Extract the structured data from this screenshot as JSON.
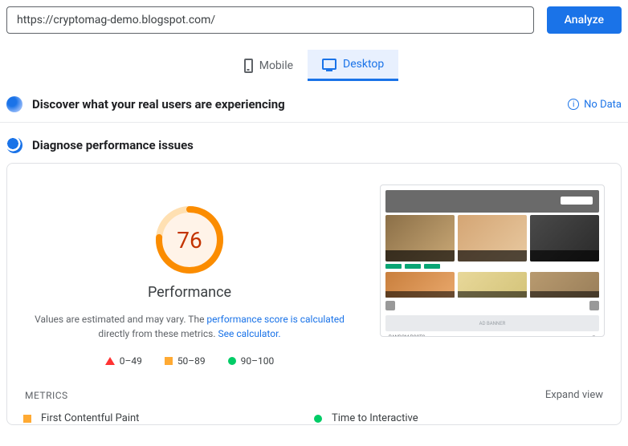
{
  "url_value": "https://cryptomag-demo.blogspot.com/",
  "analyze_label": "Analyze",
  "tabs": {
    "mobile": "Mobile",
    "desktop": "Desktop"
  },
  "discover": {
    "title": "Discover what your real users are experiencing",
    "nodata": "No Data"
  },
  "diagnose": {
    "title": "Diagnose performance issues"
  },
  "gauge": {
    "score": "76",
    "label": "Performance"
  },
  "desc": {
    "pre": "Values are estimated and may vary. The ",
    "link1": "performance score is calculated",
    "mid": " directly from these metrics. ",
    "link2": "See calculator."
  },
  "legend": {
    "bad": "0–49",
    "mid": "50–89",
    "good": "90–100"
  },
  "banner_text": "AD BANNER",
  "foot_left": "RANDOM POSTS",
  "metrics": {
    "header": "METRICS",
    "expand": "Expand view",
    "items": [
      "First Contentful Paint",
      "Time to Interactive"
    ]
  },
  "chart_data": {
    "type": "gauge",
    "title": "Performance",
    "value": 76,
    "range": [
      0,
      100
    ],
    "bands": [
      {
        "name": "bad",
        "range": [
          0,
          49
        ],
        "color": "#ff3333"
      },
      {
        "name": "average",
        "range": [
          50,
          89
        ],
        "color": "#ffaa33"
      },
      {
        "name": "good",
        "range": [
          90,
          100
        ],
        "color": "#00cc66"
      }
    ]
  }
}
